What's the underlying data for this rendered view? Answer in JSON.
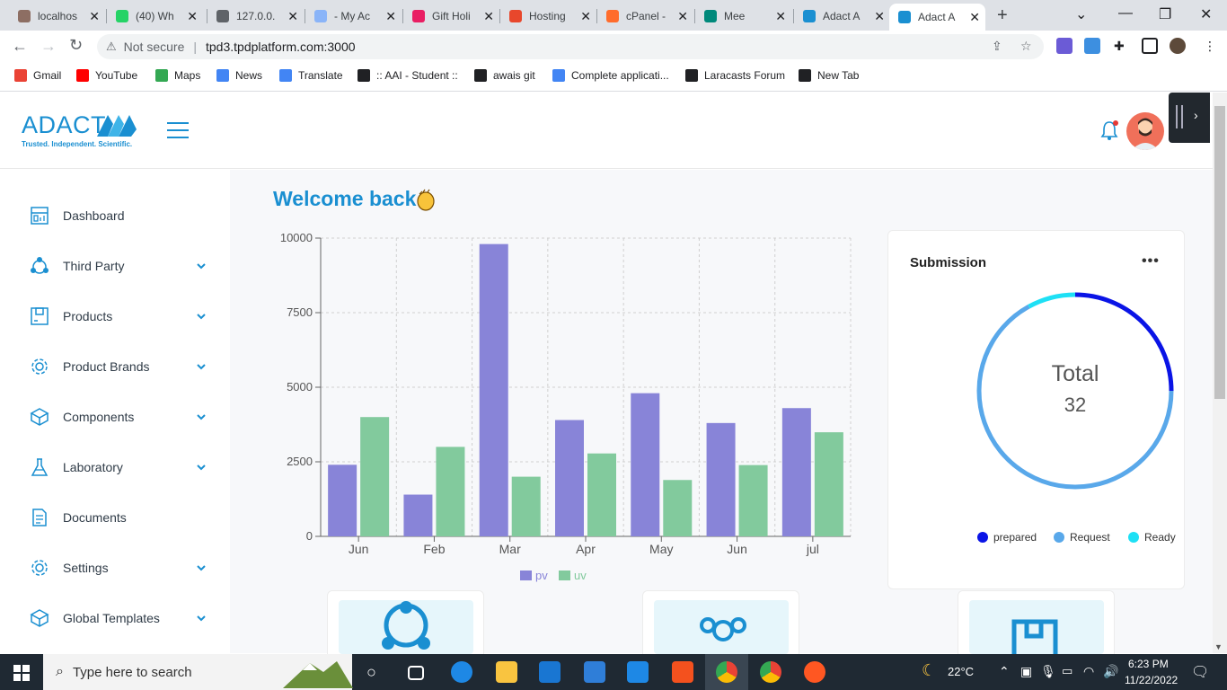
{
  "browser": {
    "tabs": [
      {
        "title": "localhos",
        "color": "#8d6e63"
      },
      {
        "title": "(40) Wh",
        "color": "#25d366"
      },
      {
        "title": "127.0.0.",
        "color": "#5f6368"
      },
      {
        "title": "- My Ac",
        "color": "#8ab4f8"
      },
      {
        "title": "Gift Holi",
        "color": "#e91e63"
      },
      {
        "title": "Hosting",
        "color": "#e8472c"
      },
      {
        "title": "cPanel -",
        "color": "#ff6c2c"
      },
      {
        "title": "Mee",
        "color": "#00897b"
      },
      {
        "title": "Adact A",
        "color": "#1a8fd1"
      },
      {
        "title": "Adact A",
        "color": "#1a8fd1"
      }
    ],
    "address": {
      "warning": "Not secure",
      "url": "tpd3.tpdplatform.com:3000"
    },
    "bookmarks": [
      {
        "label": "Gmail",
        "color": "#ea4335"
      },
      {
        "label": "YouTube",
        "color": "#ff0000"
      },
      {
        "label": "Maps",
        "color": "#34a853"
      },
      {
        "label": "News",
        "color": "#4285f4"
      },
      {
        "label": "Translate",
        "color": "#4285f4"
      },
      {
        "label": ":: AAI - Student ::",
        "color": "#202124"
      },
      {
        "label": "awais git",
        "color": "#202124"
      },
      {
        "label": "Complete applicati...",
        "color": "#4285f4"
      },
      {
        "label": "Laracasts Forum",
        "color": "#202124"
      },
      {
        "label": "New Tab",
        "color": "#202124"
      }
    ]
  },
  "app": {
    "logo": {
      "name": "ADACT",
      "tagline": "Trusted. Independent. Scientific."
    },
    "accent": "#1a8fd1",
    "welcome": "Welcome back"
  },
  "sidebar": {
    "items": [
      {
        "label": "Dashboard",
        "icon": "dashboard-icon",
        "expandable": false
      },
      {
        "label": "Third Party",
        "icon": "network-icon",
        "expandable": true
      },
      {
        "label": "Products",
        "icon": "product-icon",
        "expandable": true
      },
      {
        "label": "Product Brands",
        "icon": "gear-icon",
        "expandable": true
      },
      {
        "label": "Components",
        "icon": "cube-icon",
        "expandable": true
      },
      {
        "label": "Laboratory",
        "icon": "flask-icon",
        "expandable": true
      },
      {
        "label": "Documents",
        "icon": "document-icon",
        "expandable": false
      },
      {
        "label": "Settings",
        "icon": "gear-icon",
        "expandable": true
      },
      {
        "label": "Global Templates",
        "icon": "cube-icon",
        "expandable": true
      }
    ]
  },
  "chart_data": {
    "type": "bar",
    "categories": [
      "Jun",
      "Feb",
      "Mar",
      "Apr",
      "May",
      "Jun",
      "jul"
    ],
    "series": [
      {
        "name": "pv",
        "color": "#8884d8",
        "values": [
          2400,
          1400,
          9800,
          3900,
          4800,
          3800,
          4300
        ]
      },
      {
        "name": "uv",
        "color": "#82ca9d",
        "values": [
          4000,
          3000,
          2000,
          2780,
          1890,
          2390,
          3490
        ]
      }
    ],
    "yticks": [
      "0",
      "2500",
      "5000",
      "7500",
      "10000"
    ],
    "ylim": [
      0,
      10000
    ],
    "grid": true,
    "legend": "bottom"
  },
  "submission": {
    "title": "Submission",
    "more": "•••",
    "total_label": "Total",
    "total_value": "32",
    "legend": [
      {
        "label": "prepared",
        "color": "#0a14e6"
      },
      {
        "label": "Request",
        "color": "#59a8ea"
      },
      {
        "label": "Ready",
        "color": "#1ee0f5"
      }
    ],
    "slices": [
      {
        "label": "prepared",
        "value": 0.25
      },
      {
        "label": "Request",
        "value": 0.67
      },
      {
        "label": "Ready",
        "value": 0.08
      }
    ]
  },
  "taskbar": {
    "search_placeholder": "Type here to search",
    "weather": "22°C",
    "time": "6:23 PM",
    "date": "11/22/2022"
  }
}
